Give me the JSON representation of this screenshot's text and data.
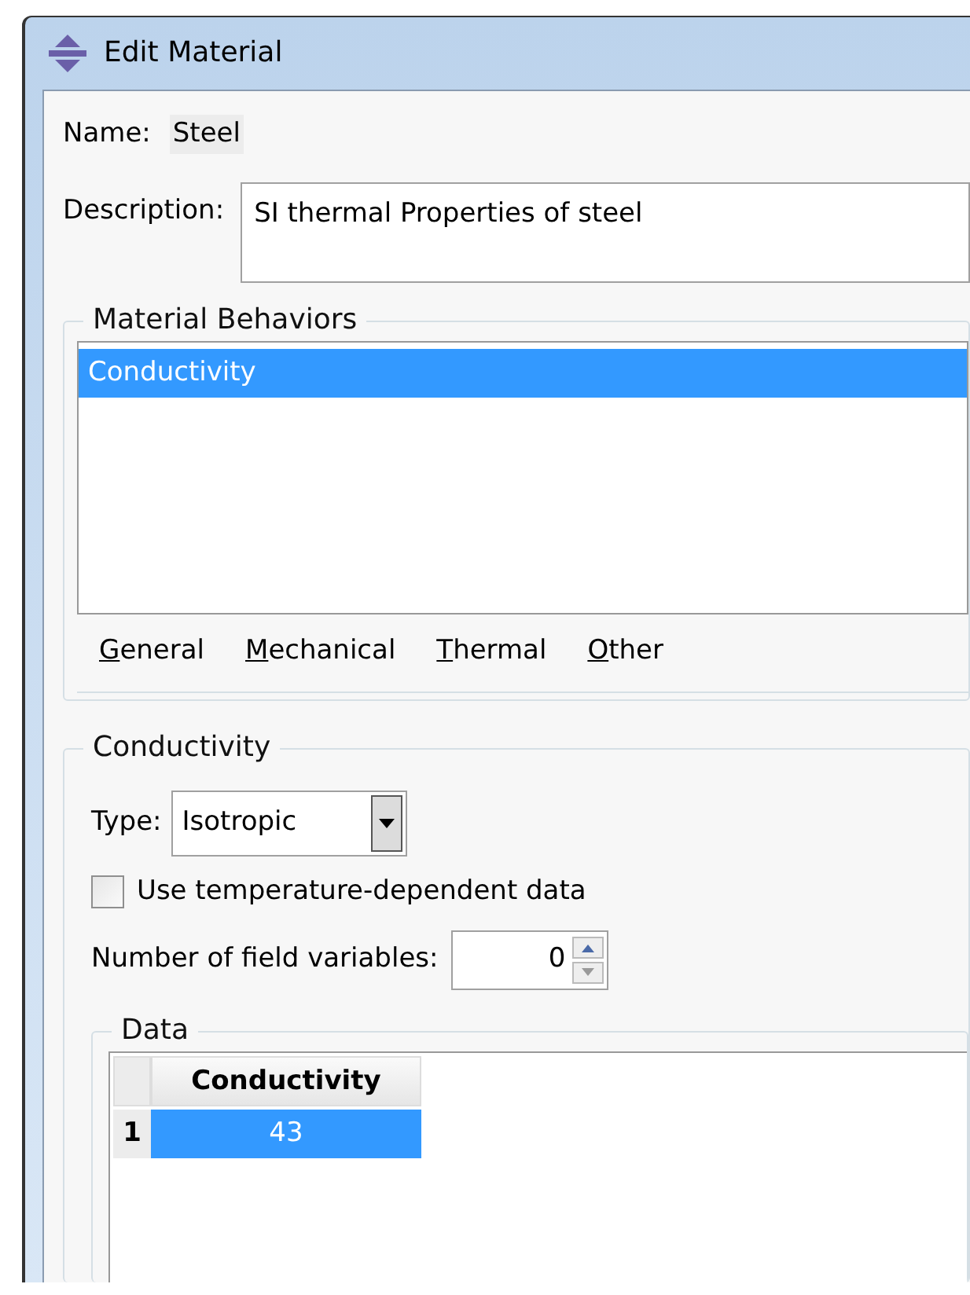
{
  "window": {
    "title": "Edit Material"
  },
  "name": {
    "label": "Name:",
    "value": "Steel"
  },
  "description": {
    "label": "Description:",
    "value": "SI thermal Properties of steel"
  },
  "material_behaviors": {
    "title": "Material Behaviors",
    "items": [
      {
        "label": "Conductivity",
        "selected": true
      }
    ],
    "menus": [
      {
        "label": "General"
      },
      {
        "label": "Mechanical"
      },
      {
        "label": "Thermal"
      },
      {
        "label": "Other"
      }
    ]
  },
  "conductivity": {
    "title": "Conductivity",
    "type": {
      "label": "Type:",
      "value": "Isotropic"
    },
    "temperature_dependent": {
      "label": "Use temperature-dependent data",
      "checked": false
    },
    "field_variables": {
      "label": "Number of field variables:",
      "value": "0"
    },
    "data": {
      "title": "Data",
      "columns": [
        "Conductivity"
      ],
      "rows": [
        {
          "index": "1",
          "cells": [
            "43"
          ],
          "selected": true
        }
      ]
    }
  }
}
